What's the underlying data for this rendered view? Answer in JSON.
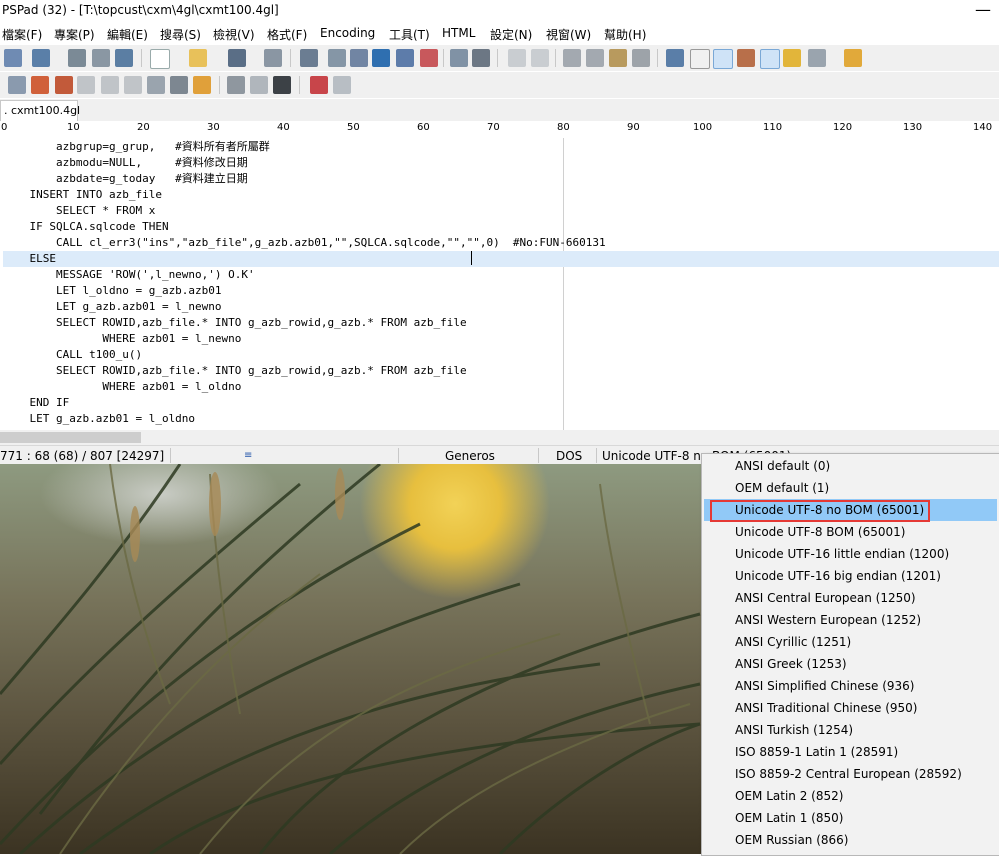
{
  "window": {
    "title": "PSPad (32) - [T:\\topcust\\cxm\\4gl\\cxmt100.4gl]"
  },
  "menu": [
    "檔案(F)",
    "專案(P)",
    "編輯(E)",
    "搜尋(S)",
    "檢視(V)",
    "格式(F)",
    "Encoding",
    "工具(T)",
    "HTML",
    "設定(N)",
    "視窗(W)",
    "幫助(H)"
  ],
  "tabs": [
    {
      "label": ". cxmt100.4gl"
    }
  ],
  "ruler": [
    "0",
    "10",
    "20",
    "30",
    "40",
    "50",
    "60",
    "70",
    "80",
    "90",
    "100",
    "110",
    "120",
    "130",
    "140"
  ],
  "code_lines": [
    "        azbgrup=g_grup,   #資料所有者所屬群",
    "        azbmodu=NULL,     #資料修改日期",
    "        azbdate=g_today   #資料建立日期",
    "    INSERT INTO azb_file",
    "        SELECT * FROM x",
    "    IF SQLCA.sqlcode THEN",
    "        CALL cl_err3(\"ins\",\"azb_file\",g_azb.azb01,\"\",SQLCA.sqlcode,\"\",\"\",0)  #No:FUN-660131",
    "    ELSE",
    "        MESSAGE 'ROW(',l_newno,') O.K'",
    "        LET l_oldno = g_azb.azb01",
    "        LET g_azb.azb01 = l_newno",
    "        SELECT ROWID,azb_file.* INTO g_azb_rowid,g_azb.* FROM azb_file",
    "               WHERE azb01 = l_newno",
    "        CALL t100_u()",
    "        SELECT ROWID,azb_file.* INTO g_azb_rowid,g_azb.* FROM azb_file",
    "               WHERE azb01 = l_oldno",
    "    END IF",
    "    LET g_azb.azb01 = l_oldno"
  ],
  "status": {
    "position": "771 : 68 (68) / 807  [24297]",
    "highlighter": "Generos",
    "line_end": "DOS",
    "encoding": "Unicode UTF-8 no BOM (65001)"
  },
  "encoding_menu": {
    "selected": "Unicode UTF-8 no BOM (65001)",
    "items": [
      "ANSI default (0)",
      "OEM default (1)",
      "Unicode UTF-8 no BOM (65001)",
      "Unicode UTF-8 BOM (65001)",
      "Unicode UTF-16 little endian (1200)",
      "Unicode UTF-16 big endian (1201)",
      "ANSI Central European (1250)",
      "ANSI Western European (1252)",
      "ANSI Cyrillic (1251)",
      "ANSI Greek (1253)",
      "ANSI Simplified Chinese (936)",
      "ANSI Traditional Chinese (950)",
      "ANSI Turkish (1254)",
      "ISO 8859-1 Latin 1 (28591)",
      "ISO 8859-2 Central European (28592)",
      "OEM Latin 2 (852)",
      "OEM Latin 1 (850)",
      "OEM Russian (866)"
    ]
  },
  "colors": {
    "accent_selection": "#91c9f7",
    "highlight_box": "#e53935",
    "comment": "#1010c8",
    "current_line": "#dcebfa"
  }
}
